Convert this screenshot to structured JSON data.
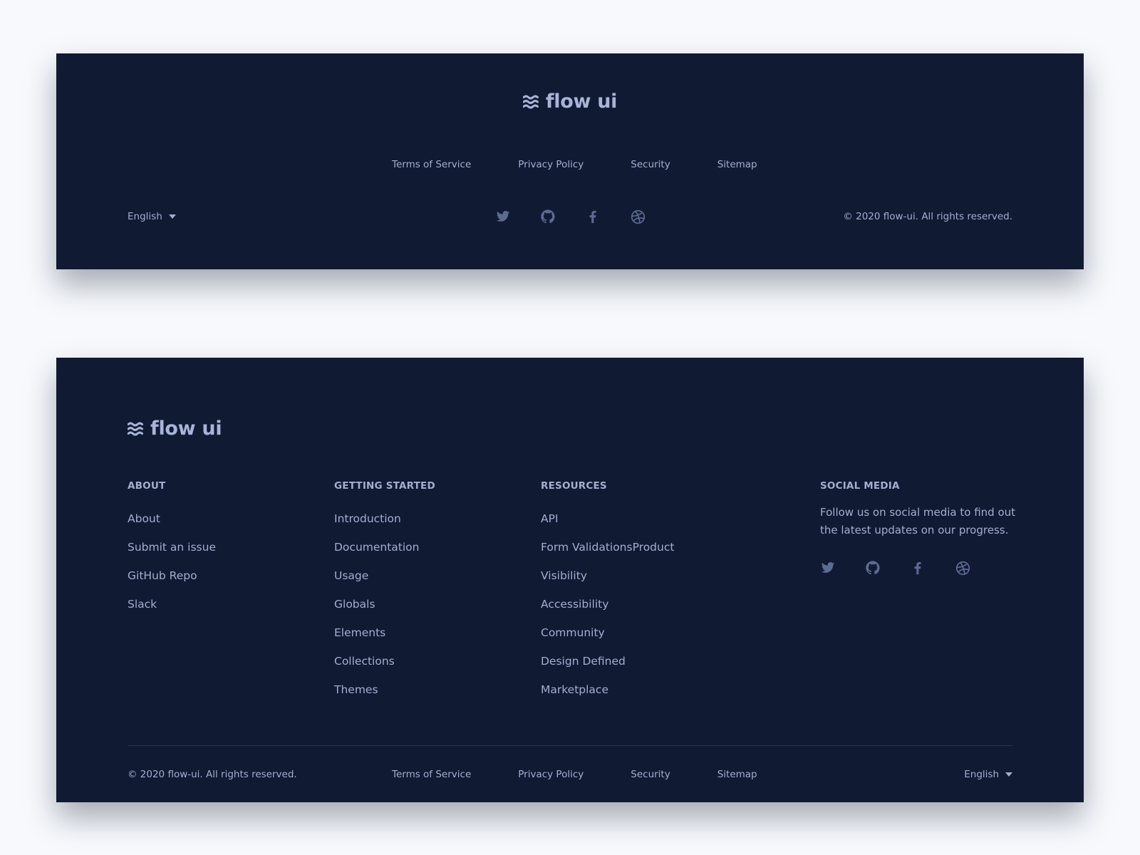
{
  "brand": {
    "name": "flow ui",
    "logo_icon": "waves-icon"
  },
  "colors": {
    "footer_bg": "#111a33",
    "page_bg": "#f7f9fc",
    "text": "#a3aed0",
    "icon": "#5d6a91"
  },
  "simple_footer": {
    "links": [
      "Terms of Service",
      "Privacy Policy",
      "Security",
      "Sitemap"
    ],
    "language": "English",
    "social": [
      "twitter-icon",
      "github-icon",
      "facebook-icon",
      "dribbble-icon"
    ],
    "copyright": "© 2020 flow-ui. All rights reserved."
  },
  "full_footer": {
    "columns": {
      "about": {
        "title": "ABOUT",
        "items": [
          "About",
          "Submit an issue",
          "GitHub Repo",
          "Slack"
        ]
      },
      "getting_started": {
        "title": "GETTING STARTED",
        "items": [
          "Introduction",
          "Documentation",
          "Usage",
          "Globals",
          "Elements",
          "Collections",
          "Themes"
        ]
      },
      "resources": {
        "title": "RESOURCES",
        "items": [
          "API",
          "Form ValidationsProduct",
          "Visibility",
          "Accessibility",
          "Community",
          "Design Defined",
          "Marketplace"
        ]
      },
      "social_media": {
        "title": "SOCIAL MEDIA",
        "description": "Follow us on social media to find out the latest updates on our progress."
      }
    },
    "social": [
      "twitter-icon",
      "github-icon",
      "facebook-icon",
      "dribbble-icon"
    ],
    "copyright": "© 2020 flow-ui. All rights reserved.",
    "links": [
      "Terms of Service",
      "Privacy Policy",
      "Security",
      "Sitemap"
    ],
    "language": "English"
  }
}
